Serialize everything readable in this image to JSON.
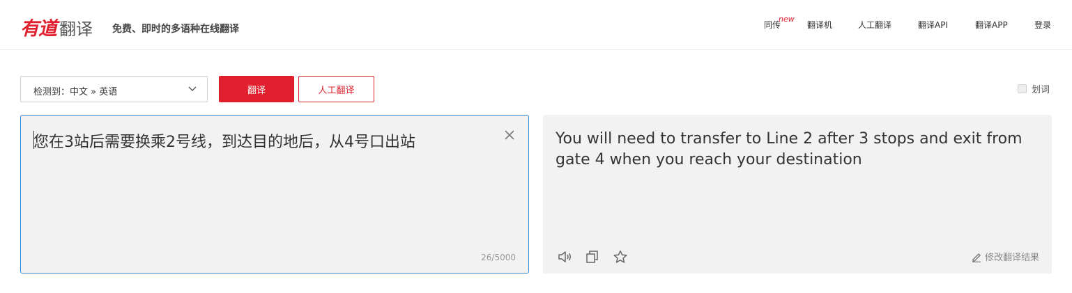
{
  "header": {
    "logo_brand": "有道",
    "logo_product": "翻译",
    "slogan": "免费、即时的多语种在线翻译",
    "nav": {
      "tongchuan": "同传",
      "tongchuan_badge": "new",
      "translator_device": "翻译机",
      "human_translation": "人工翻译",
      "api": "翻译API",
      "app": "翻译APP",
      "login": "登录"
    }
  },
  "toolbar": {
    "language_select": "检测到：中文 » 英语",
    "translate_button": "翻译",
    "human_button": "人工翻译",
    "huaci_label": "划词",
    "huaci_checked": false
  },
  "input": {
    "text": "您在3站后需要换乘2号线，到达目的地后，从4号口出站",
    "char_count": "26/5000"
  },
  "output": {
    "text": "You will need to transfer to Line 2 after 3 stops and exit from gate 4 when you reach your destination",
    "edit_label": "修改翻译结果",
    "icons": [
      "speaker-icon",
      "copy-icon",
      "star-icon",
      "pencil-icon"
    ]
  },
  "colors": {
    "brand_red": "#e0202f",
    "panel_bg": "#f2f2f2",
    "focus_border": "#3b8ad3"
  }
}
